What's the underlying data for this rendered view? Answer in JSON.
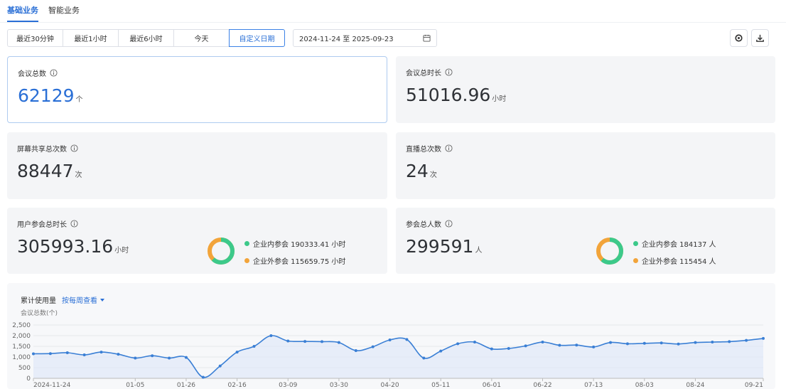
{
  "tabs": [
    {
      "label": "基础业务",
      "active": true
    },
    {
      "label": "智能业务",
      "active": false
    }
  ],
  "toolbar": {
    "ranges": [
      "最近30分钟",
      "最近1小时",
      "最近6小时",
      "今天",
      "自定义日期"
    ],
    "active_range": "自定义日期",
    "date_range": "2024-11-24 至 2025-09-23"
  },
  "stats": {
    "meetings": {
      "label": "会议总数",
      "value": "62129",
      "unit": "个"
    },
    "duration": {
      "label": "会议总时长",
      "value": "51016.96",
      "unit": "小时"
    },
    "screen_share": {
      "label": "屏幕共享总次数",
      "value": "88447",
      "unit": "次"
    },
    "live": {
      "label": "直播总次数",
      "value": "24",
      "unit": "次"
    },
    "user_duration": {
      "label": "用户参会总时长",
      "value": "305993.16",
      "unit": "小时",
      "inside": "企业内参会 190333.41 小时",
      "outside": "企业外参会 115659.75 小时",
      "inside_value": 190333.41,
      "outside_value": 115659.75
    },
    "participants": {
      "label": "参会总人数",
      "value": "299591",
      "unit": "人",
      "inside": "企业内参会 184137 人",
      "outside": "企业外参会 115454 人",
      "inside_value": 184137,
      "outside_value": 115454
    }
  },
  "colors": {
    "accent": "#2a6fd6",
    "inside": "#3cc98a",
    "outside": "#f2a43a",
    "line": "#3a7fd5"
  },
  "chart": {
    "title": "累计使用量",
    "switch_label": "按每周查看",
    "ylabel": "会议总数(个)"
  },
  "chart_data": {
    "type": "area",
    "ylabel": "会议总数(个)",
    "ylim": [
      0,
      2500
    ],
    "yticks": [
      0,
      500,
      1000,
      1500,
      2000,
      2500
    ],
    "xtick_labels": [
      "2024-11-24",
      "01-05",
      "01-26",
      "02-16",
      "03-09",
      "03-30",
      "04-20",
      "05-11",
      "06-01",
      "06-22",
      "07-13",
      "08-03",
      "08-24",
      "09-21"
    ],
    "xtick_positions": [
      0,
      6,
      9,
      12,
      15,
      18,
      21,
      24,
      27,
      30,
      33,
      36,
      39,
      43
    ],
    "series": [
      {
        "values": [
          1150,
          1160,
          1200,
          1100,
          1230,
          1130,
          950,
          1060,
          950,
          980,
          50,
          580,
          1230,
          1500,
          2000,
          1750,
          1730,
          1720,
          1680,
          1300,
          1480,
          1800,
          1820,
          950,
          1280,
          1620,
          1700,
          1380,
          1400,
          1520,
          1700,
          1550,
          1560,
          1470,
          1680,
          1620,
          1640,
          1660,
          1610,
          1680,
          1700,
          1720,
          1780,
          1870
        ]
      }
    ]
  }
}
